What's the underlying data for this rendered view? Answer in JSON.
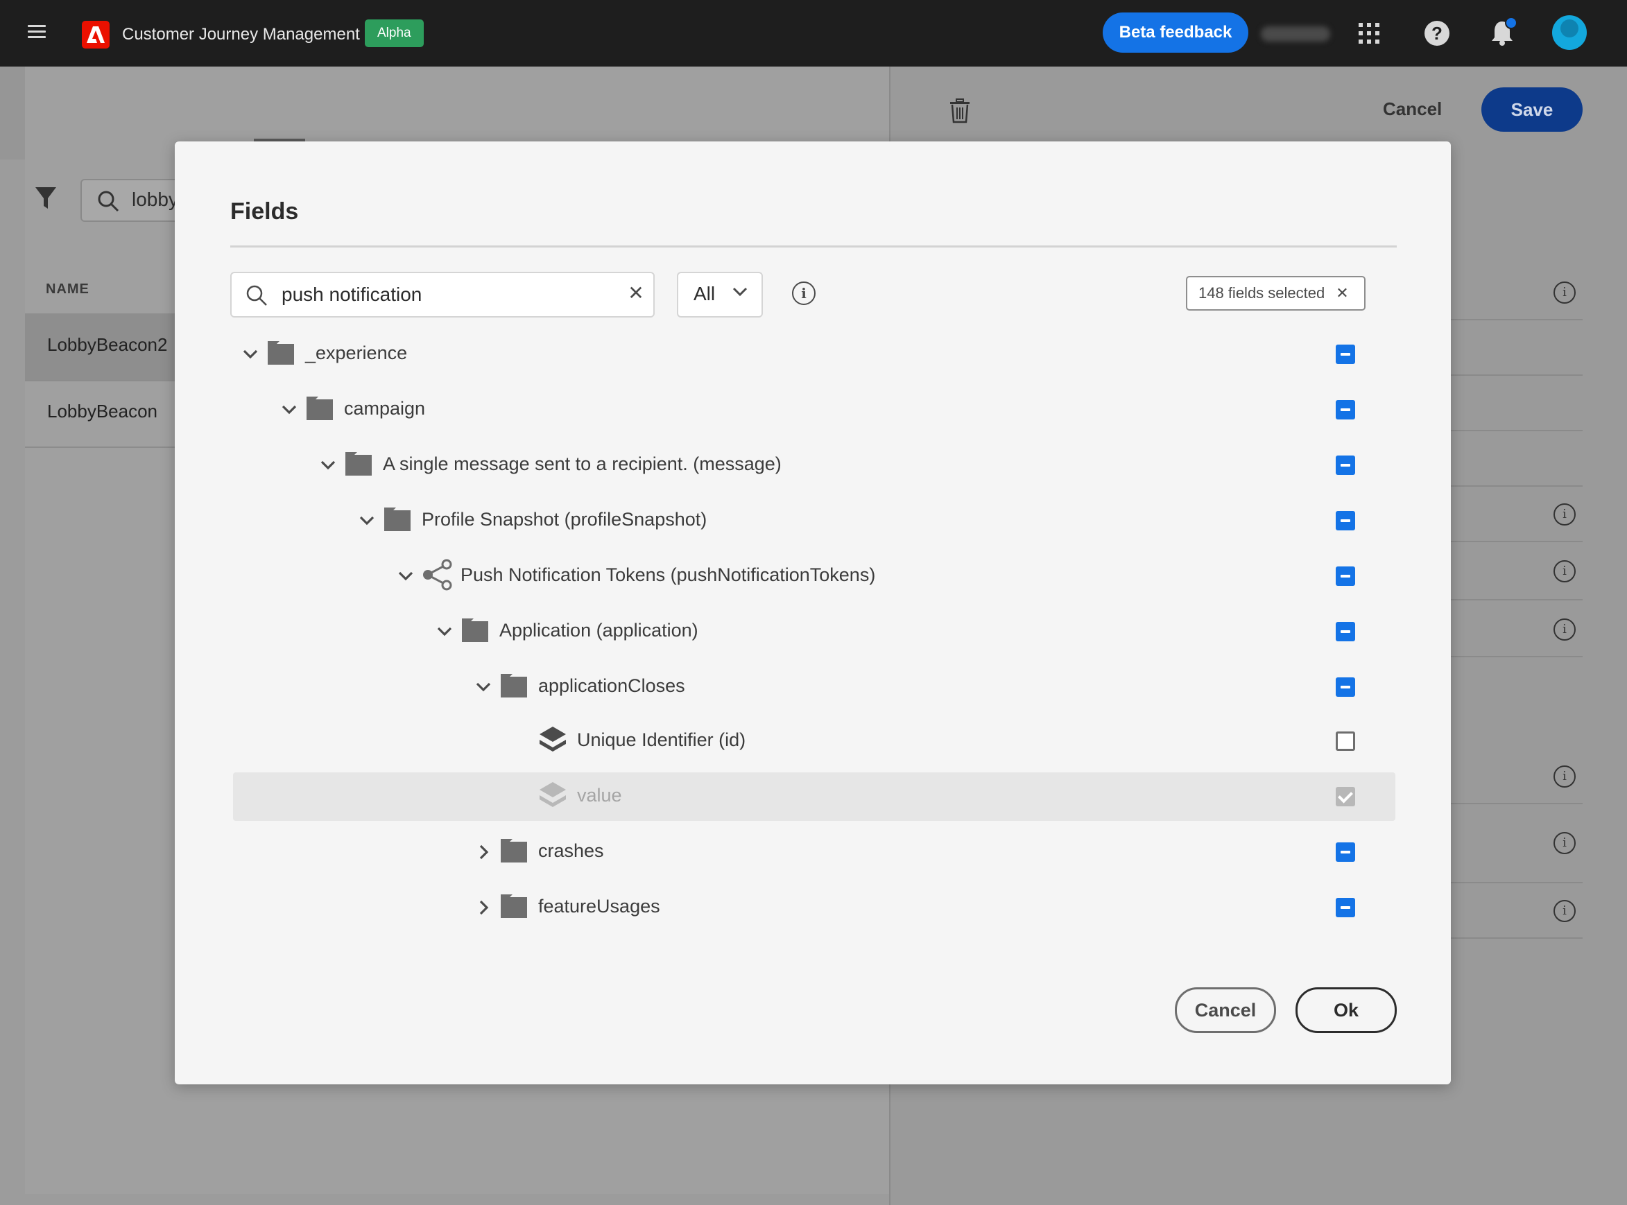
{
  "topbar": {
    "app_title": "Customer Journey Management",
    "badge": "Alpha",
    "beta_feedback": "Beta feedback",
    "help": "?"
  },
  "background": {
    "search_value": "lobby",
    "column_name": "NAME",
    "rows": [
      "LobbyBeacon2",
      "LobbyBeacon"
    ],
    "cancel_label": "Cancel",
    "save_label": "Save",
    "info_glyph": "i"
  },
  "modal": {
    "title": "Fields",
    "search": {
      "value": "push notification",
      "clear": "✕"
    },
    "filter": {
      "selected": "All"
    },
    "info_glyph": "i",
    "selected_count": "148 fields selected",
    "tree": [
      {
        "label": "_experience",
        "icon": "folder-icon",
        "expanded": true,
        "state": "indeterminate"
      },
      {
        "label": "campaign",
        "icon": "folder-icon",
        "expanded": true,
        "state": "indeterminate"
      },
      {
        "label": "A single message sent to a recipient. (message)",
        "icon": "folder-icon",
        "expanded": true,
        "state": "indeterminate"
      },
      {
        "label": "Profile Snapshot (profileSnapshot)",
        "icon": "folder-icon",
        "expanded": true,
        "state": "indeterminate"
      },
      {
        "label": "Push Notification Tokens (pushNotificationTokens)",
        "icon": "share-icon",
        "expanded": true,
        "state": "indeterminate"
      },
      {
        "label": "Application (application)",
        "icon": "folder-icon",
        "expanded": true,
        "state": "indeterminate"
      },
      {
        "label": "applicationCloses",
        "icon": "folder-icon",
        "expanded": true,
        "state": "indeterminate"
      },
      {
        "label": "Unique Identifier (id)",
        "icon": "layers-icon",
        "state": "unchecked"
      },
      {
        "label": "value",
        "icon": "layers-icon",
        "state": "checked-disabled"
      },
      {
        "label": "crashes",
        "icon": "folder-icon",
        "expanded": false,
        "state": "indeterminate"
      },
      {
        "label": "featureUsages",
        "icon": "folder-icon",
        "expanded": false,
        "state": "indeterminate"
      }
    ],
    "cancel_label": "Cancel",
    "ok_label": "Ok"
  },
  "colors": {
    "accent": "#1473e6",
    "topbar": "#1e1e1e",
    "alpha_badge": "#2d9d5c",
    "adobe_red": "#eb1000"
  }
}
